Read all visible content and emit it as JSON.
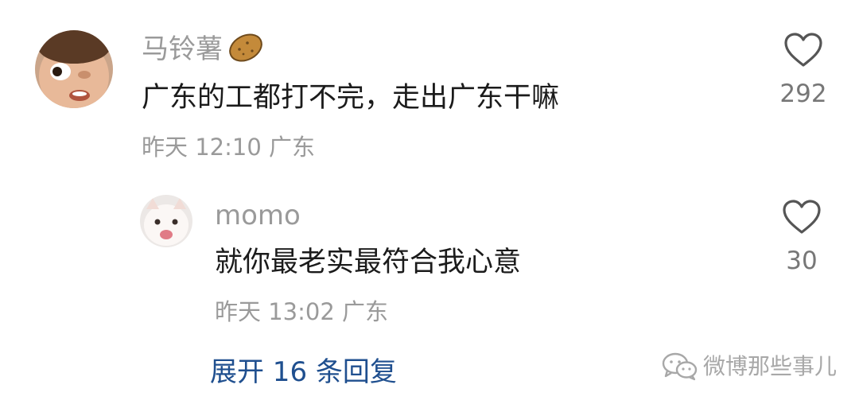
{
  "comments": [
    {
      "username": "马铃薯",
      "badge_icon": "potato-emoji-icon",
      "text": "广东的工都打不完，走出广东干嘛",
      "time": "昨天 12:10",
      "location": "广东",
      "likes": "292"
    }
  ],
  "reply": {
    "username": "momo",
    "text": "就你最老实最符合我心意",
    "time": "昨天 13:02",
    "location": "广东",
    "likes": "30"
  },
  "expand_replies": {
    "label": "展开 16 条回复"
  },
  "watermark": {
    "icon": "wechat-icon",
    "text": "微博那些事儿"
  },
  "colors": {
    "username": "#9a9a9a",
    "text": "#1b1b1b",
    "link": "#1f4f8f",
    "heart": "#555555"
  }
}
